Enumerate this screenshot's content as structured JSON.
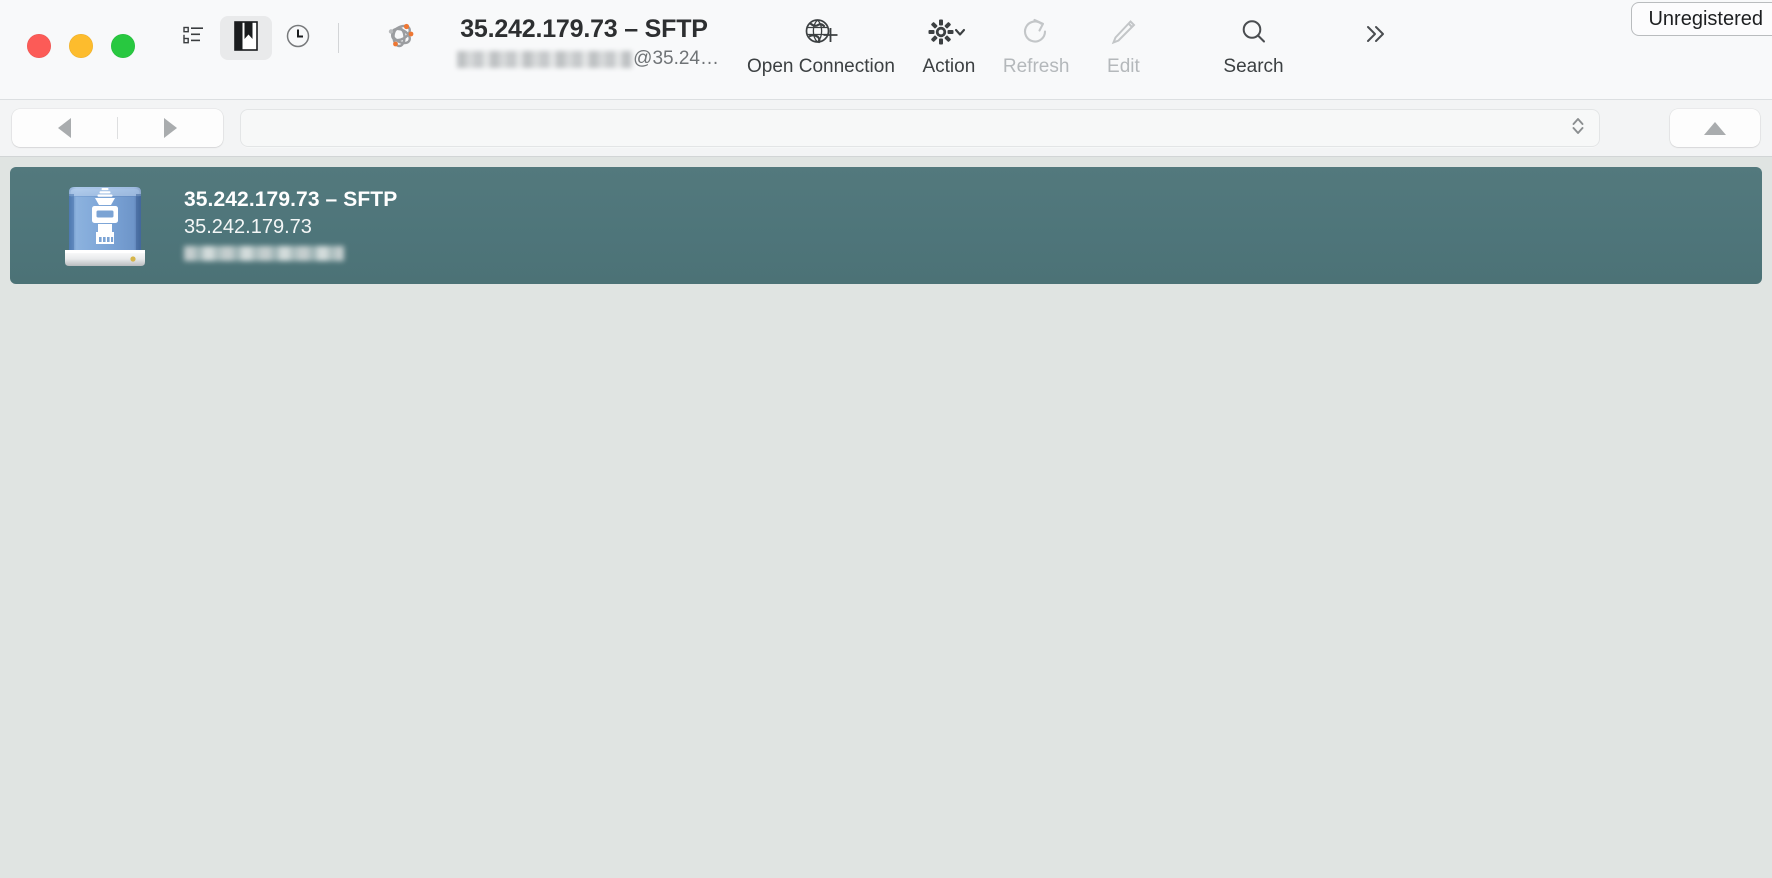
{
  "window": {
    "traffic_lights": [
      {
        "name": "close",
        "color": "#fc5b57"
      },
      {
        "name": "minimize",
        "color": "#fdbc2d"
      },
      {
        "name": "zoom",
        "color": "#28c840"
      }
    ]
  },
  "toolbar": {
    "modes": [
      {
        "id": "outline",
        "icon": "list-outline-icon",
        "selected": false
      },
      {
        "id": "bookmarks",
        "icon": "bookmark-icon",
        "selected": true
      },
      {
        "id": "history",
        "icon": "clock-icon",
        "selected": false
      }
    ],
    "app_icon": "cyberduck-app-icon",
    "title": "35.242.179.73 – SFTP",
    "subtitle_suffix": "@35.24…",
    "subtitle_redacted": true,
    "items": [
      {
        "id": "open-connection",
        "label": "Open Connection",
        "icon": "globe-plus-icon",
        "disabled": false,
        "has_menu": false
      },
      {
        "id": "action",
        "label": "Action",
        "icon": "gear-icon",
        "disabled": false,
        "has_menu": true
      },
      {
        "id": "refresh",
        "label": "Refresh",
        "icon": "refresh-icon",
        "disabled": true,
        "has_menu": false
      },
      {
        "id": "edit",
        "label": "Edit",
        "icon": "pencil-icon",
        "disabled": true,
        "has_menu": false
      },
      {
        "id": "search",
        "label": "Search",
        "icon": "search-icon",
        "disabled": false,
        "has_menu": false
      }
    ],
    "overflow_icon": "double-chevron-right-icon",
    "unregistered_label": "Unregistered"
  },
  "navbar": {
    "back_icon": "triangle-left-icon",
    "forward_icon": "triangle-right-icon",
    "path_value": "",
    "path_placeholder": "",
    "path_stepper_icon": "up-down-chevron-icon",
    "up_icon": "triangle-up-icon"
  },
  "bookmarks": {
    "selection_color": "#4f777b",
    "background_color": "#e0e4e2",
    "rows": [
      {
        "icon": "network-drive-icon",
        "title": "35.242.179.73 – SFTP",
        "hostname": "35.242.179.73",
        "username_redacted": true,
        "selected": true
      }
    ]
  }
}
